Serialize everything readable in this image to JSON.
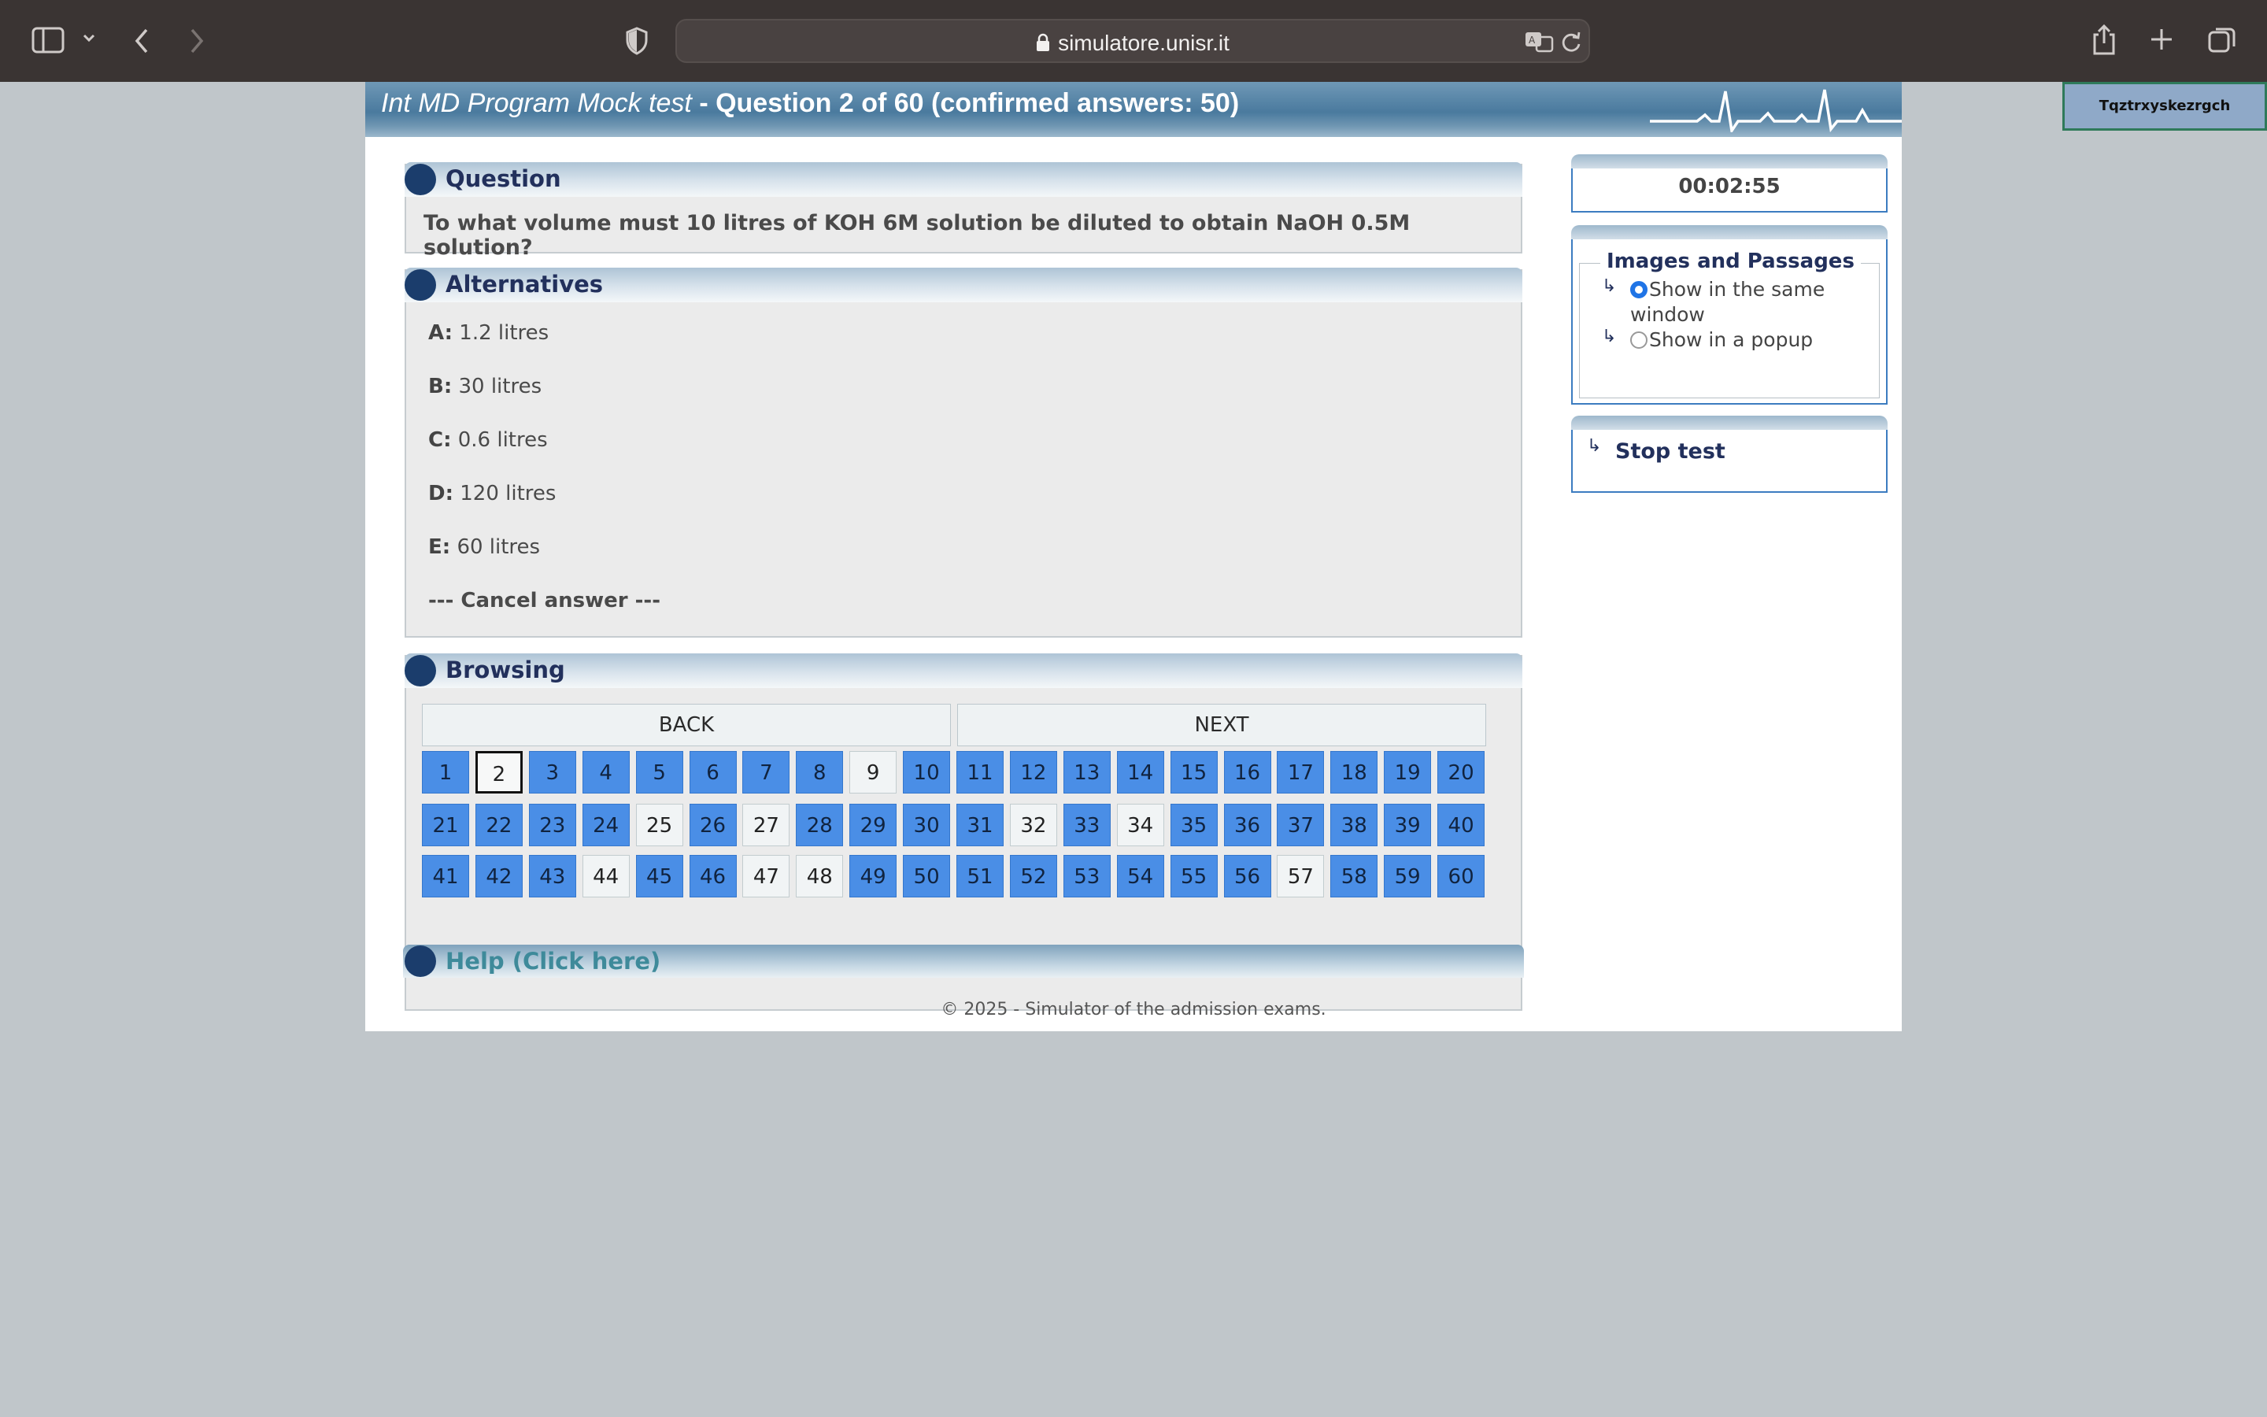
{
  "browser": {
    "url": "simulatore.unisr.it"
  },
  "banner": {
    "test_name": "Int MD Program Mock test",
    "separator": " - ",
    "question_status": "Question 2 of 60 (confirmed answers: 50)"
  },
  "user_tab": "Tqztrxyskezrgch",
  "question": {
    "heading": "Question",
    "text": "To what volume must 10 litres of KOH 6M solution be diluted to obtain NaOH 0.5M solution?"
  },
  "alternatives": {
    "heading": "Alternatives",
    "items": [
      {
        "letter": "A:",
        "text": "1.2 litres"
      },
      {
        "letter": "B:",
        "text": "30 litres"
      },
      {
        "letter": "C:",
        "text": "0.6 litres"
      },
      {
        "letter": "D:",
        "text": "120 litres"
      },
      {
        "letter": "E:",
        "text": "60 litres"
      }
    ],
    "cancel": "--- Cancel answer ---"
  },
  "browsing": {
    "heading": "Browsing",
    "back": "BACK",
    "next": "NEXT",
    "current": 2,
    "unanswered": [
      9,
      25,
      27,
      32,
      34,
      44,
      47,
      48,
      57
    ],
    "total": 60
  },
  "help": {
    "heading": "Help (Click here)"
  },
  "footer": "© 2025 - Simulator of the admission exams.",
  "sidebar": {
    "timer": "00:02:55",
    "images_passages": {
      "legend": "Images and Passages",
      "option_same_line1": "Show in the same",
      "option_same_line2": "window",
      "option_popup": "Show in a popup",
      "selected": "same"
    },
    "stop": "Stop test"
  }
}
